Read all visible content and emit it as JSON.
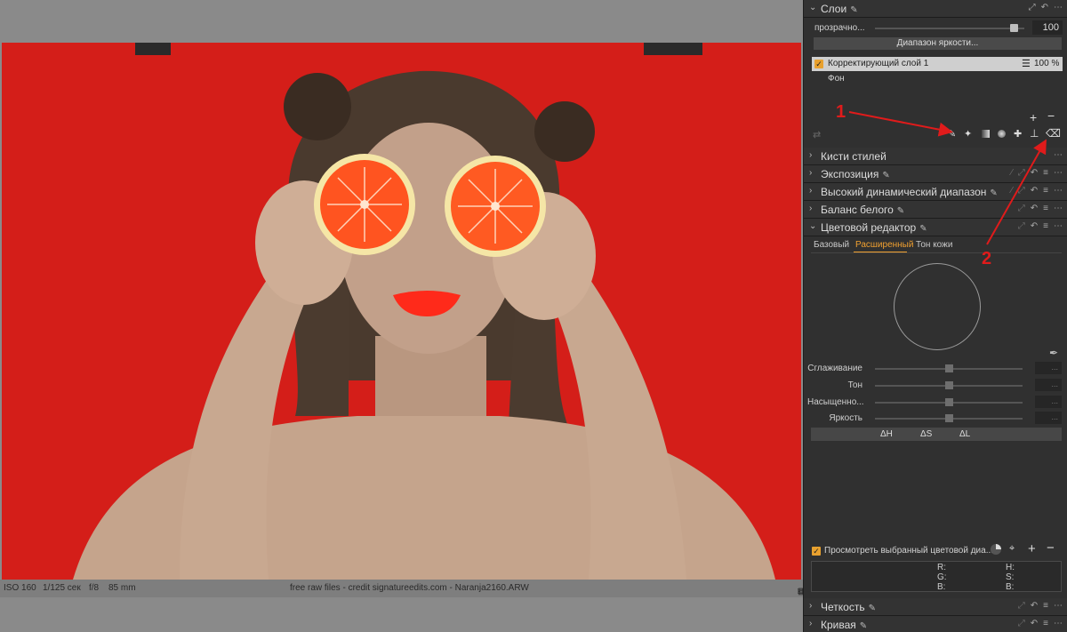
{
  "status_bar": {
    "iso": "ISO 160",
    "shutter": "1/125 сек",
    "aperture": "f/8",
    "focal": "85 mm",
    "center_text": "free raw files - credit signatureedits.com - Naranja2160.ARW"
  },
  "layers_panel": {
    "title": "Слои",
    "opacity_label": "прозрачно...",
    "opacity_value": "100",
    "opacity_level": 0.93,
    "luma_range_button": "Диапазон яркости...",
    "layers": [
      {
        "name": "Корректирующий слой 1",
        "value": "100 %",
        "selected": true
      },
      {
        "name": "Фон",
        "value": "",
        "selected": false
      }
    ]
  },
  "sections": {
    "style_brushes": "Кисти стилей",
    "exposure": "Экспозиция",
    "hdr": "Высокий динамический диапазон",
    "white_balance": "Баланс белого",
    "color_editor": "Цветовой редактор",
    "clarity": "Четкость",
    "curve": "Кривая"
  },
  "color_editor": {
    "tabs": [
      "Базовый",
      "Расширенный",
      "Тон кожи"
    ],
    "active_tab": "Расширенный",
    "props": [
      {
        "label": "Сглаживание",
        "value": "..."
      },
      {
        "label": "Тон",
        "value": "..."
      },
      {
        "label": "Насыщенно...",
        "value": "..."
      },
      {
        "label": "Яркость",
        "value": "..."
      }
    ],
    "deltas": [
      "ΔH",
      "ΔS",
      "ΔL"
    ],
    "view_selected_label": "Просмотреть выбранный цветовой диа...",
    "readout": {
      "r": "R:",
      "g": "G:",
      "b": "B:",
      "h": "H:",
      "s": "S:",
      "b2": "B:"
    }
  },
  "annotations": {
    "one": "1",
    "two": "2"
  },
  "colors": {
    "accent": "#f0a030",
    "annotation": "#e01b1b",
    "background_red": "#d41e19"
  }
}
